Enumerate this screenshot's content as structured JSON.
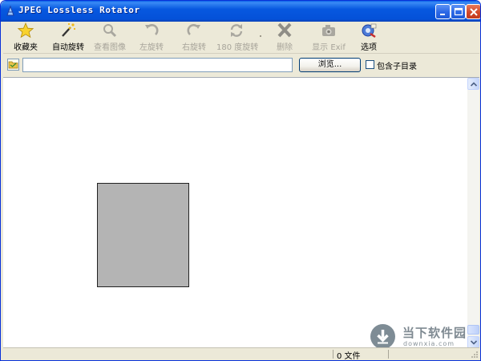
{
  "window": {
    "title": "JPEG Lossless Rotator"
  },
  "toolbar": {
    "items": [
      {
        "label": "收藏夹",
        "icon": "star-icon",
        "enabled": true
      },
      {
        "label": "自动旋转",
        "icon": "magic-wand-icon",
        "enabled": true
      },
      {
        "label": "查看图像",
        "icon": "magnifier-icon",
        "enabled": false
      },
      {
        "label": "左旋转",
        "icon": "rotate-left-icon",
        "enabled": false
      },
      {
        "label": "右旋转",
        "icon": "rotate-right-icon",
        "enabled": false
      },
      {
        "label": "180 度旋转",
        "icon": "rotate-180-icon",
        "enabled": false
      },
      {
        "label": "删除",
        "icon": "delete-x-icon",
        "enabled": false
      },
      {
        "label": "显示 Exif",
        "icon": "camera-icon",
        "enabled": false
      },
      {
        "label": "选项",
        "icon": "options-icon",
        "enabled": true
      }
    ]
  },
  "addressbar": {
    "path_value": "",
    "browse_label": "浏览...",
    "include_subdirs_label": "包含子目录",
    "include_subdirs_checked": false
  },
  "watermark": {
    "name": "当下软件园",
    "url": "downxia.com"
  },
  "statusbar": {
    "file_count": "0 文件"
  },
  "colors": {
    "titlebar": "#0451D8",
    "chrome": "#ECE9D8",
    "thumbnail": "#B4B4B4",
    "close_button": "#D2482A"
  }
}
